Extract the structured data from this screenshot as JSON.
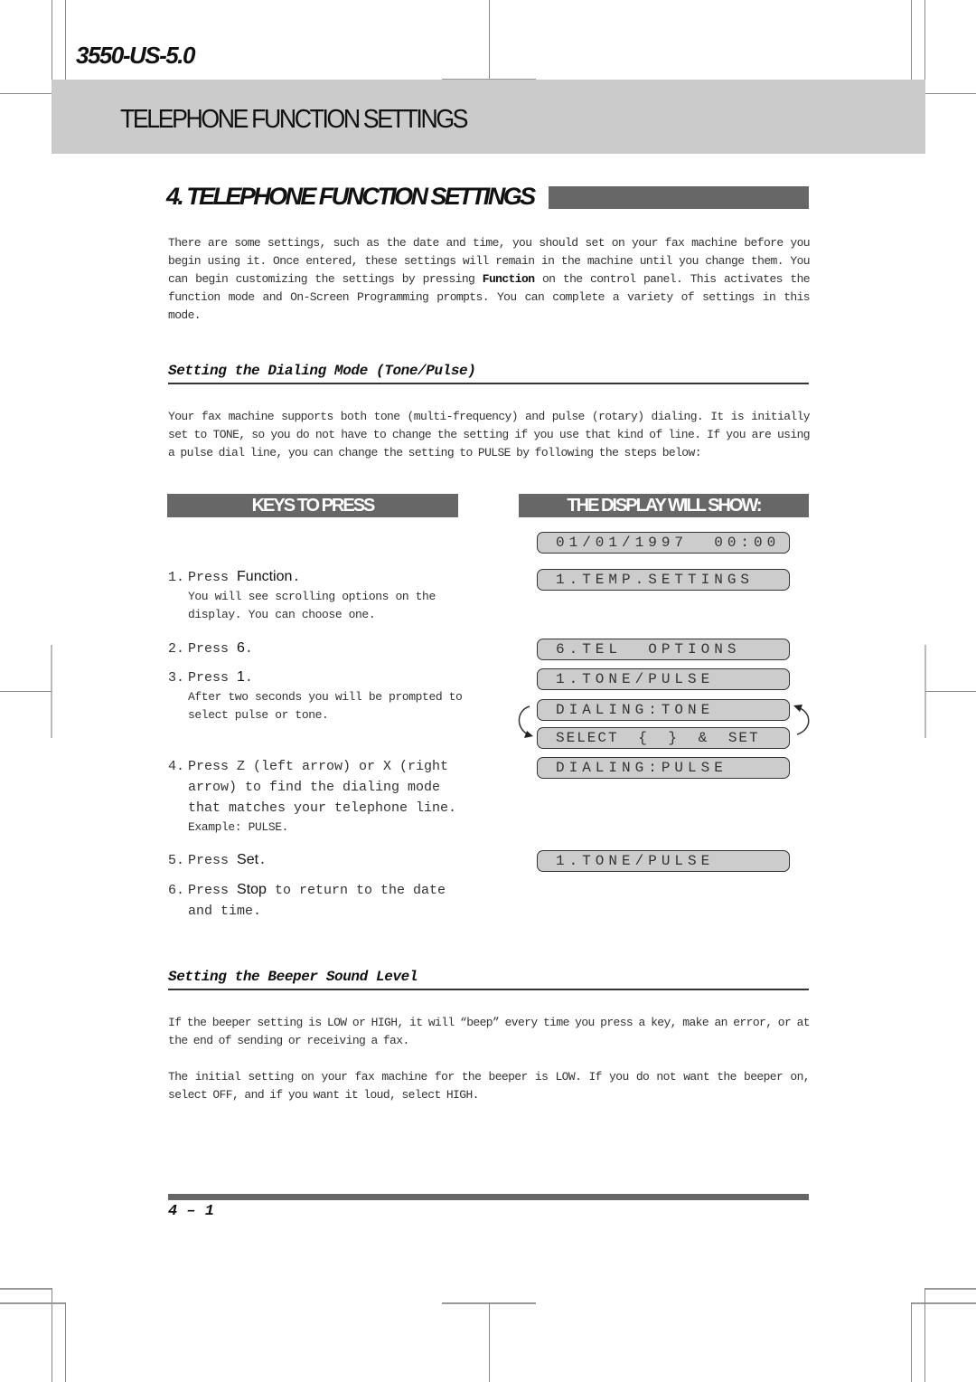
{
  "header": {
    "model": "3550-US-5.0",
    "banner_title": "TELEPHONE FUNCTION SETTINGS"
  },
  "chapter": {
    "title": "4. TELEPHONE FUNCTION SETTINGS"
  },
  "intro": {
    "before_bold": "There are some settings, such as the date and time, you should set on your fax machine before you begin using it. Once entered, these settings will remain in the machine until you change them. You can begin customizing the settings by pressing ",
    "bold": "Function",
    "after_bold": " on the control panel. This activates the function mode and On-Screen Programming prompts. You can complete a variety of settings in this mode."
  },
  "dialing_mode": {
    "heading": "Setting the Dialing Mode (Tone/Pulse)",
    "paragraph": "Your fax machine supports both tone (multi-frequency) and pulse (rotary) dialing. It is initially set to TONE, so you do not have to change the setting if you use that kind of line. If you are using a pulse dial line, you can change the setting to PULSE by following the steps below:",
    "keys_header": "KEYS TO PRESS",
    "display_header": "THE DISPLAY WILL SHOW:",
    "steps": [
      {
        "num": "1.",
        "prefix": "Press ",
        "key": "Function",
        "suffix": ".",
        "note": "You will see scrolling options on the display. You can choose one."
      },
      {
        "num": "2.",
        "prefix": "Press ",
        "key": "6",
        "suffix": "."
      },
      {
        "num": "3.",
        "prefix": "Press ",
        "key": "1",
        "suffix": ".",
        "note": "After two seconds you will be prompted to select pulse or tone."
      },
      {
        "num": "4.",
        "text_line1": "Press Z (left arrow) or X (right",
        "text_rest": "arrow) to find the dialing mode that matches your telephone line.",
        "note": "Example: PULSE."
      },
      {
        "num": "5.",
        "prefix": "Press ",
        "key": "Set",
        "suffix": "."
      },
      {
        "num": "6.",
        "prefix": "Press ",
        "key": "Stop",
        "suffix": " to return to the date",
        "cont": "and time."
      }
    ],
    "lcd": [
      "01/01/1997  00:00",
      "1.TEMP.SETTINGS",
      "6.TEL  OPTIONS",
      "1.TONE/PULSE",
      "DIALING:TONE",
      "SELECT { } & SET",
      "DIALING:PULSE",
      "1.TONE/PULSE"
    ]
  },
  "beeper": {
    "heading": "Setting the Beeper Sound Level",
    "paragraph1": "If the beeper setting is LOW or HIGH, it will “beep” every time you press a key, make an error, or at the end of sending or receiving a fax.",
    "paragraph2": "The initial setting on your fax machine for the beeper is LOW. If you do not want the beeper on, select OFF, and if you want it loud, select HIGH."
  },
  "footer": {
    "page_number": "4 – 1"
  }
}
